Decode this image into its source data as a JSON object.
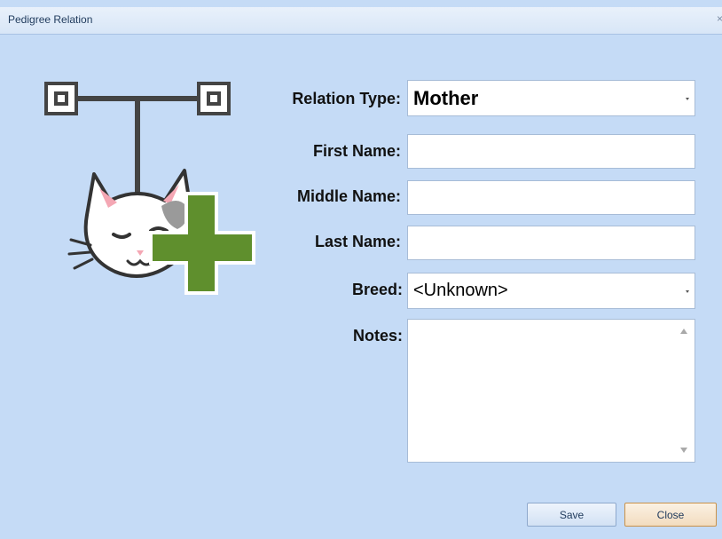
{
  "window": {
    "title": "Pedigree Relation",
    "close_glyph": "×",
    "background": "#c5dbf6"
  },
  "form": {
    "relation_type": {
      "label": "Relation Type:",
      "value": "Mother"
    },
    "first_name": {
      "label": "First Name:",
      "value": ""
    },
    "middle_name": {
      "label": "Middle Name:",
      "value": ""
    },
    "last_name": {
      "label": "Last Name:",
      "value": ""
    },
    "breed": {
      "label": "Breed:",
      "value": "<Unknown>"
    },
    "notes": {
      "label": "Notes:",
      "value": ""
    }
  },
  "buttons": {
    "save": "Save",
    "close": "Close"
  },
  "icons": {
    "illustration": "pedigree-add-cat-icon",
    "accent_green": "#5f8f2d"
  }
}
